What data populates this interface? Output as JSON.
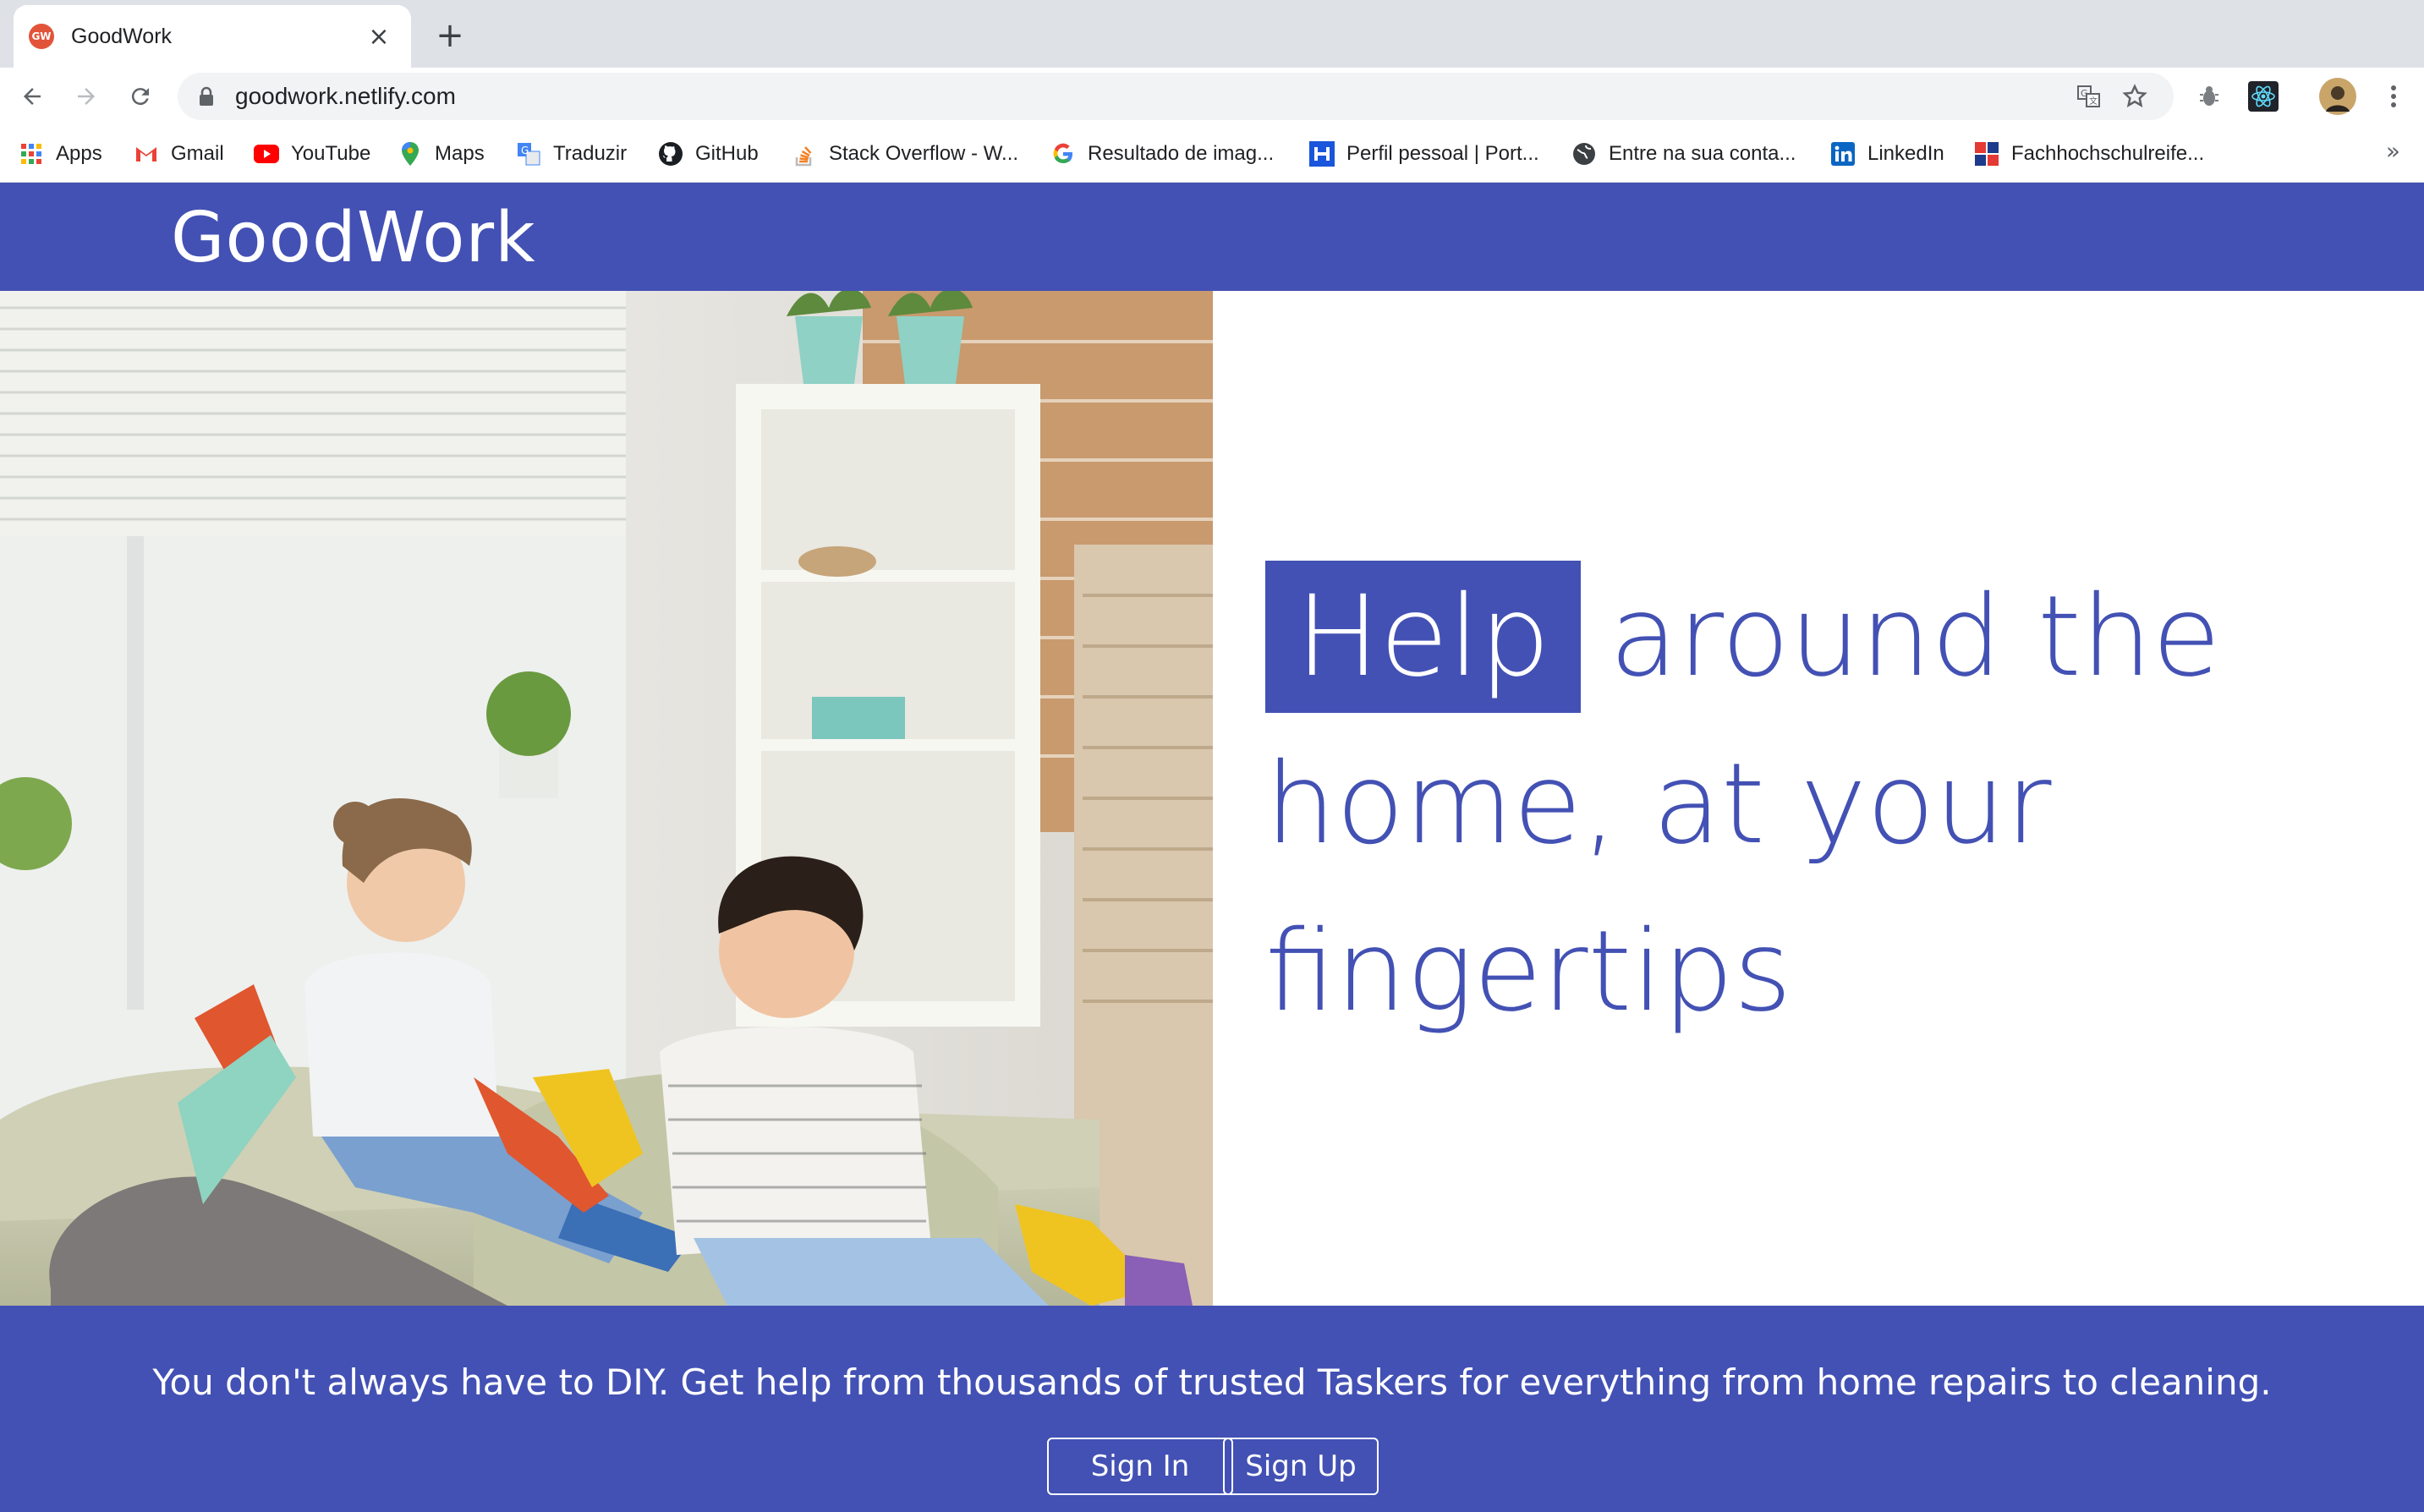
{
  "browser": {
    "tab": {
      "title": "GoodWork",
      "favicon_text": "GW"
    },
    "url": "goodwork.netlify.com",
    "bookmarks": [
      {
        "label": "Apps",
        "icon": "apps-grid-icon"
      },
      {
        "label": "Gmail",
        "icon": "gmail-icon"
      },
      {
        "label": "YouTube",
        "icon": "youtube-icon"
      },
      {
        "label": "Maps",
        "icon": "maps-icon"
      },
      {
        "label": "Traduzir",
        "icon": "translate-icon"
      },
      {
        "label": "GitHub",
        "icon": "github-icon"
      },
      {
        "label": "Stack Overflow - W...",
        "icon": "stackoverflow-icon"
      },
      {
        "label": "Resultado de imag...",
        "icon": "google-icon"
      },
      {
        "label": "Perfil pessoal | Port...",
        "icon": "portal-icon"
      },
      {
        "label": "Entre na sua conta...",
        "icon": "globe-icon"
      },
      {
        "label": "LinkedIn",
        "icon": "linkedin-icon"
      },
      {
        "label": "Fachhochschulreife...",
        "icon": "fachhochschule-icon"
      }
    ],
    "more_bookmarks": "»"
  },
  "site": {
    "brand": "GoodWork",
    "headline": {
      "highlight": "Help",
      "line1_rest": "around the",
      "line2": "home, at your",
      "line3": "fingertips"
    },
    "tagline": "You don't always have to DIY. Get help from thousands of trusted Taskers for everything from home repairs to cleaning.",
    "buttons": {
      "sign_in": "Sign In",
      "sign_up": "Sign Up"
    }
  },
  "colors": {
    "brand": "#4351b4",
    "chrome_tabstrip": "#dee1e6",
    "omnibox": "#f1f3f4"
  }
}
